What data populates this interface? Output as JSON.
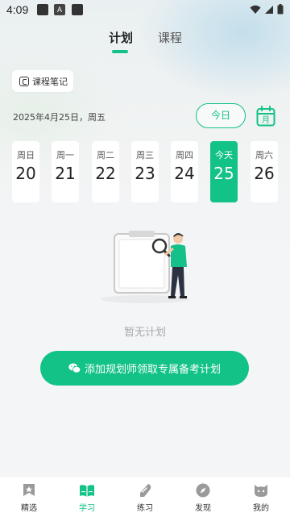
{
  "status_bar": {
    "time": "4:09",
    "icon2_text": "A"
  },
  "tabs": [
    {
      "label": "计划",
      "active": true
    },
    {
      "label": "课程",
      "active": false
    }
  ],
  "notes_button": {
    "label": "课程笔记",
    "icon": "notebook-icon"
  },
  "date": {
    "text": "2025年4月25日，周五"
  },
  "today_button": {
    "label": "今日"
  },
  "calendar_icon": {
    "label": "月"
  },
  "week": [
    {
      "weekday": "周日",
      "day": "20",
      "selected": false
    },
    {
      "weekday": "周一",
      "day": "21",
      "selected": false
    },
    {
      "weekday": "周二",
      "day": "22",
      "selected": false
    },
    {
      "weekday": "周三",
      "day": "23",
      "selected": false
    },
    {
      "weekday": "周四",
      "day": "24",
      "selected": false
    },
    {
      "weekday": "今天",
      "day": "25",
      "selected": true
    },
    {
      "weekday": "周六",
      "day": "26",
      "selected": false
    }
  ],
  "empty_state": {
    "text": "暂无计划",
    "illustration": "person-with-magnifier-clipboard"
  },
  "cta": {
    "label": "添加规划师领取专属备考计划",
    "icon": "wechat-icon"
  },
  "bottom_nav": [
    {
      "label": "精选",
      "icon": "star-bookmark-icon",
      "active": false
    },
    {
      "label": "学习",
      "icon": "open-book-icon",
      "active": true
    },
    {
      "label": "练习",
      "icon": "pen-icon",
      "active": false
    },
    {
      "label": "发现",
      "icon": "compass-icon",
      "active": false
    },
    {
      "label": "我的",
      "icon": "cat-face-icon",
      "active": false
    }
  ],
  "colors": {
    "accent": "#12c287",
    "background": "#f4f5f7"
  }
}
